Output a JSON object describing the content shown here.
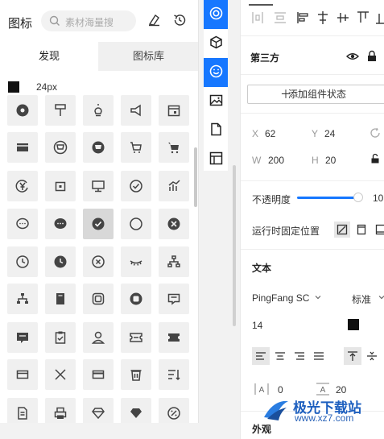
{
  "icon_panel": {
    "title": "图标",
    "search_placeholder": "素材海量搜",
    "tabs": [
      {
        "label": "发现",
        "active": true
      },
      {
        "label": "图标库",
        "active": false
      }
    ],
    "color": "#111111",
    "size": "24px",
    "icons": [
      "eye-circle",
      "paint-roller",
      "lightbulb",
      "megaphone",
      "calendar",
      "card",
      "cart-circle-outline",
      "cart-circle",
      "cart-outline",
      "cart",
      "yen-circle",
      "calendar-small",
      "monitor",
      "check-circle-outline",
      "bar-chart",
      "chat-outline",
      "chat",
      "check-circle",
      "circle-outline",
      "close-circle",
      "clock-outline",
      "clock",
      "close-circle-outline",
      "eyelash",
      "org-chart-outline",
      "org-chart",
      "notebook",
      "square-frame",
      "square-chat",
      "message-square",
      "message-box",
      "clipboard-check",
      "user",
      "ticket-outline",
      "ticket",
      "card-outline",
      "close",
      "card-box",
      "trash",
      "sort-list",
      "document",
      "printer",
      "diamond-outline",
      "diamond",
      "percent-circle"
    ]
  },
  "toolbar": {
    "items": [
      "target-icon",
      "component-icon",
      "smiley-icon",
      "image-icon",
      "file-icon",
      "layout-icon"
    ],
    "active": [
      "target-icon",
      "smiley-icon"
    ],
    "accent": "#1677ff"
  },
  "props": {
    "third_party": "第三方",
    "add_state": "添加组件状态",
    "x_label": "X",
    "x_value": "62",
    "y_label": "Y",
    "y_value": "24",
    "w_label": "W",
    "w_value": "200",
    "h_label": "H",
    "h_value": "20",
    "opacity_label": "不透明度",
    "opacity_value": "10",
    "fixed_label": "运行时固定位置",
    "text_section": "文本",
    "font_family": "PingFang SC",
    "font_weight": "标准",
    "font_size": "14",
    "text_color": "#111111",
    "letter_spacing": "0",
    "line_height": "20",
    "appearance": "外观"
  },
  "watermark": {
    "title": "极光下载站",
    "url": "www.xz7.com"
  }
}
